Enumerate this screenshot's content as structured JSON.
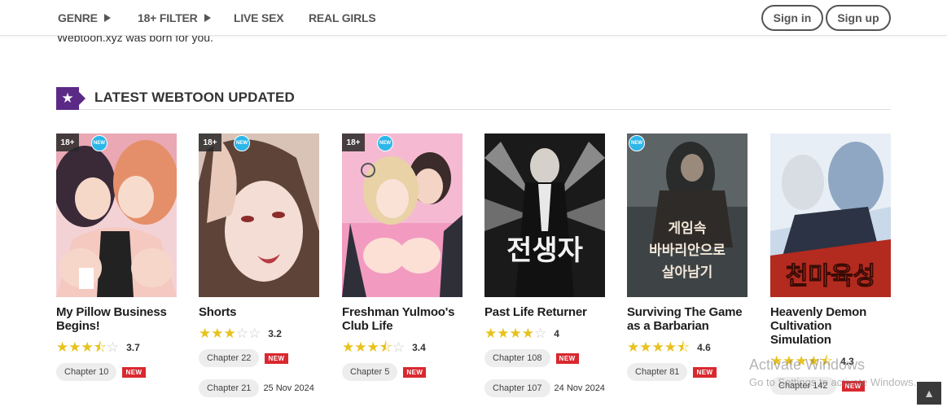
{
  "nav": {
    "genre": "GENRE",
    "filter": "18+ FILTER",
    "live_sex": "LIVE SEX",
    "real_girls": "REAL GIRLS",
    "sign_in": "Sign in",
    "sign_up": "Sign up"
  },
  "intro_text": "Webtoon.xyz was born for you.",
  "section": {
    "title": "LATEST WEBTOON UPDATED"
  },
  "badges": {
    "adult": "18+",
    "new_cover": "NEW",
    "new_chapter": "NEW"
  },
  "cards": [
    {
      "title": "My Pillow Business Begins!",
      "rating": "3.7",
      "chapter1": "Chapter 10",
      "chapter2": "",
      "date2": ""
    },
    {
      "title": "Shorts",
      "rating": "3.2",
      "chapter1": "Chapter 22",
      "chapter2": "Chapter 21",
      "date2": "25 Nov 2024"
    },
    {
      "title": "Freshman Yulmoo's Club Life",
      "rating": "3.4",
      "chapter1": "Chapter 5",
      "chapter2": "",
      "date2": ""
    },
    {
      "title": "Past Life Returner",
      "rating": "4",
      "chapter1": "Chapter 108",
      "chapter2": "Chapter 107",
      "date2": "24 Nov 2024"
    },
    {
      "title": "Surviving The Game as a Barbarian",
      "rating": "4.6",
      "chapter1": "Chapter 81",
      "chapter2": "",
      "date2": ""
    },
    {
      "title": "Heavenly Demon Cultivation Simulation",
      "rating": "4.3",
      "chapter1": "Chapter 142",
      "chapter2": "",
      "date2": ""
    }
  ],
  "cover_art": {
    "c4_korean": "전생자",
    "c5_korean_1": "게임속",
    "c5_korean_2": "바바리안으로",
    "c5_korean_3": "살아남기",
    "c6_korean": "천마육성"
  },
  "watermark": {
    "line1": "Activate Windows",
    "line2": "Go to Settings to activate Windows."
  },
  "colors": {
    "accent": "#5b2a86",
    "star": "#e8c21c",
    "new_badge": "#d9282f",
    "new_circle": "#2db6e8"
  },
  "icons": {
    "section": "star-icon",
    "nav_arrow": "triangle-right-icon",
    "back_to_top": "arrow-up-icon"
  }
}
